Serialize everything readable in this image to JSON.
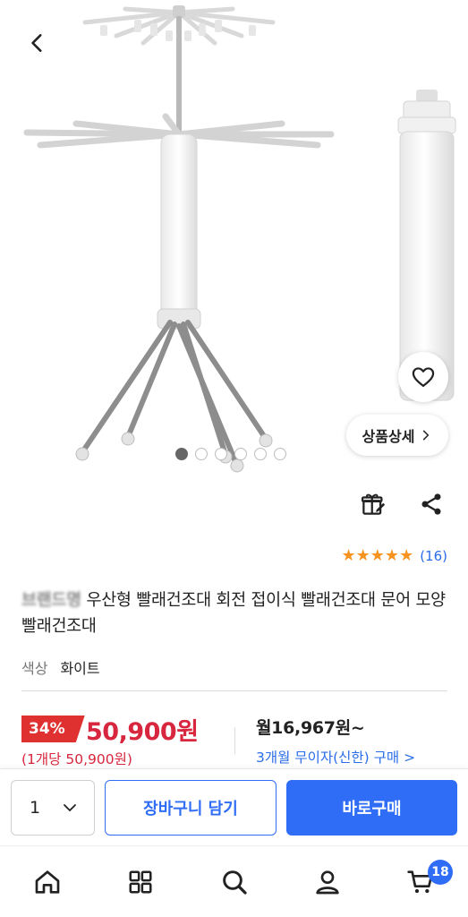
{
  "gallery": {
    "indicator_count": 6,
    "active_index": 0,
    "detail_button_label": "상품상세",
    "icons": {
      "back": "chevron-left-icon",
      "wish": "heart-outline-icon",
      "detail": "chevron-right-icon"
    }
  },
  "actions": {
    "gift_icon": "gift-icon",
    "share_icon": "share-icon"
  },
  "rating": {
    "stars": 5,
    "stars_text": "★★★★★",
    "count": "(16)"
  },
  "product": {
    "brand": "브랜드명",
    "name": "우산형 빨래건조대 회전 접이식 빨래건조대 문어 모양 빨래건조대",
    "option_label": "색상",
    "option_value": "화이트"
  },
  "price": {
    "discount": "34%",
    "sale_price": "50,900원",
    "unit_price": "(1개당 50,900원)",
    "monthly": "월16,967원~",
    "installment": "3개월 무이자(신한) 구매 >"
  },
  "buybar": {
    "quantity": "1",
    "cart_label": "장바구니 담기",
    "buy_label": "바로구매"
  },
  "nav": {
    "items": [
      "home-icon",
      "category-grid-icon",
      "search-icon",
      "my-page-icon",
      "cart-icon"
    ],
    "cart_badge": "18"
  },
  "colors": {
    "accent": "#2f6df6",
    "sale": "#d7263d",
    "badge": "#e03131",
    "star": "#f7931e",
    "link": "#2b6de8"
  }
}
